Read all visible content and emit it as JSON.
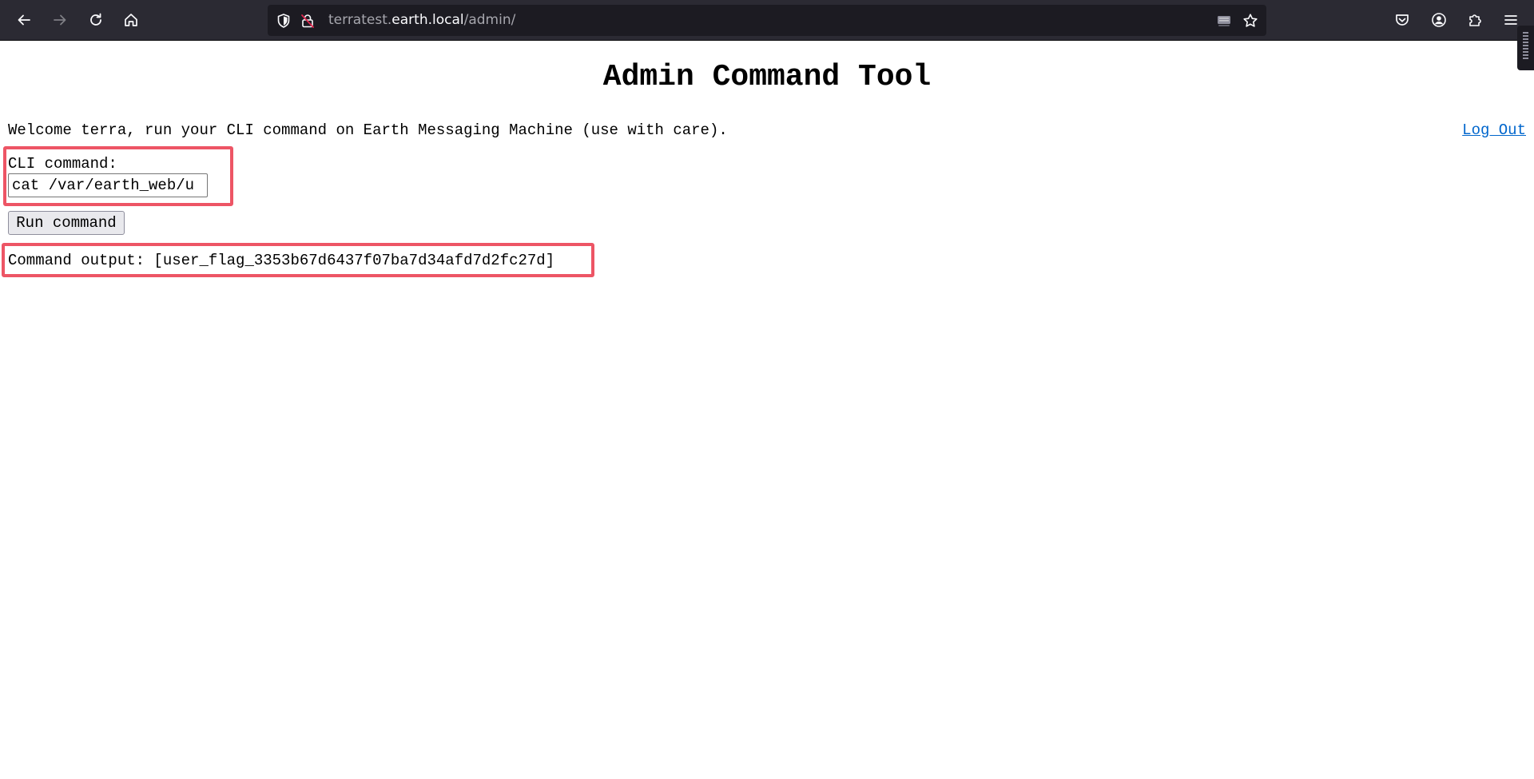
{
  "browser": {
    "url_host_prefix": "terratest.",
    "url_host_domain": "earth.local",
    "url_path": "/admin/",
    "icons": {
      "back": "arrow-left-icon",
      "forward": "arrow-right-icon",
      "reload": "reload-icon",
      "home": "home-icon",
      "tracking": "shield-icon",
      "insecure": "insecure-lock-icon",
      "reader": "reader-view-icon",
      "bookmark": "star-icon",
      "pocket": "pocket-icon",
      "account": "account-icon",
      "extensions": "puzzle-icon",
      "menu": "hamburger-menu-icon"
    }
  },
  "page": {
    "title": "Admin Command Tool",
    "welcome": "Welcome terra, run your CLI command on Earth Messaging Machine (use with care).",
    "logout_label": "Log Out",
    "cli_label": "CLI command:",
    "cli_value": "cat /var/earth_web/u",
    "run_button": "Run command",
    "output": "Command output: [user_flag_3353b67d6437f07ba7d34afd7d2fc27d]"
  },
  "colors": {
    "chrome_bg": "#2b2a33",
    "urlbar_bg": "#1c1b22",
    "link": "#0066cc",
    "annotation_box": "#ed5565"
  }
}
